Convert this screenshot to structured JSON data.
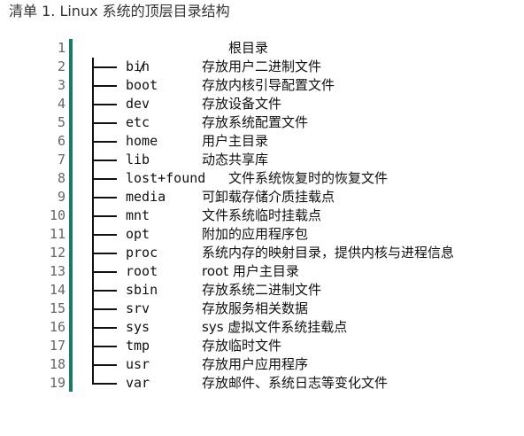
{
  "listing": {
    "title": "清单 1. Linux 系统的顶层目录结构"
  },
  "root": {
    "path": "/",
    "description": "根目录"
  },
  "line_numbers": [
    "1",
    "2",
    "3",
    "4",
    "5",
    "6",
    "7",
    "8",
    "9",
    "10",
    "11",
    "12",
    "13",
    "14",
    "15",
    "16",
    "17",
    "18",
    "19"
  ],
  "entries": [
    {
      "name": "bin",
      "description": "存放用户二进制文件"
    },
    {
      "name": "boot",
      "description": "存放内核引导配置文件"
    },
    {
      "name": "dev",
      "description": "存放设备文件"
    },
    {
      "name": "etc",
      "description": "存放系统配置文件"
    },
    {
      "name": "home",
      "description": "用户主目录"
    },
    {
      "name": "lib",
      "description": "动态共享库"
    },
    {
      "name": "lost+found",
      "description": "文件系统恢复时的恢复文件"
    },
    {
      "name": "media",
      "description": "可卸载存储介质挂载点"
    },
    {
      "name": "mnt",
      "description": "文件系统临时挂载点"
    },
    {
      "name": "opt",
      "description": "附加的应用程序包"
    },
    {
      "name": "proc",
      "description": "系统内存的映射目录，提供内核与进程信息"
    },
    {
      "name": "root",
      "description": "root 用户主目录"
    },
    {
      "name": "sbin",
      "description": "存放系统二进制文件"
    },
    {
      "name": "srv",
      "description": "存放服务相关数据"
    },
    {
      "name": "sys",
      "description": "sys 虚拟文件系统挂载点"
    },
    {
      "name": "tmp",
      "description": "存放临时文件"
    },
    {
      "name": "usr",
      "description": "存放用户应用程序"
    },
    {
      "name": "var",
      "description": "存放邮件、系统日志等变化文件"
    }
  ]
}
